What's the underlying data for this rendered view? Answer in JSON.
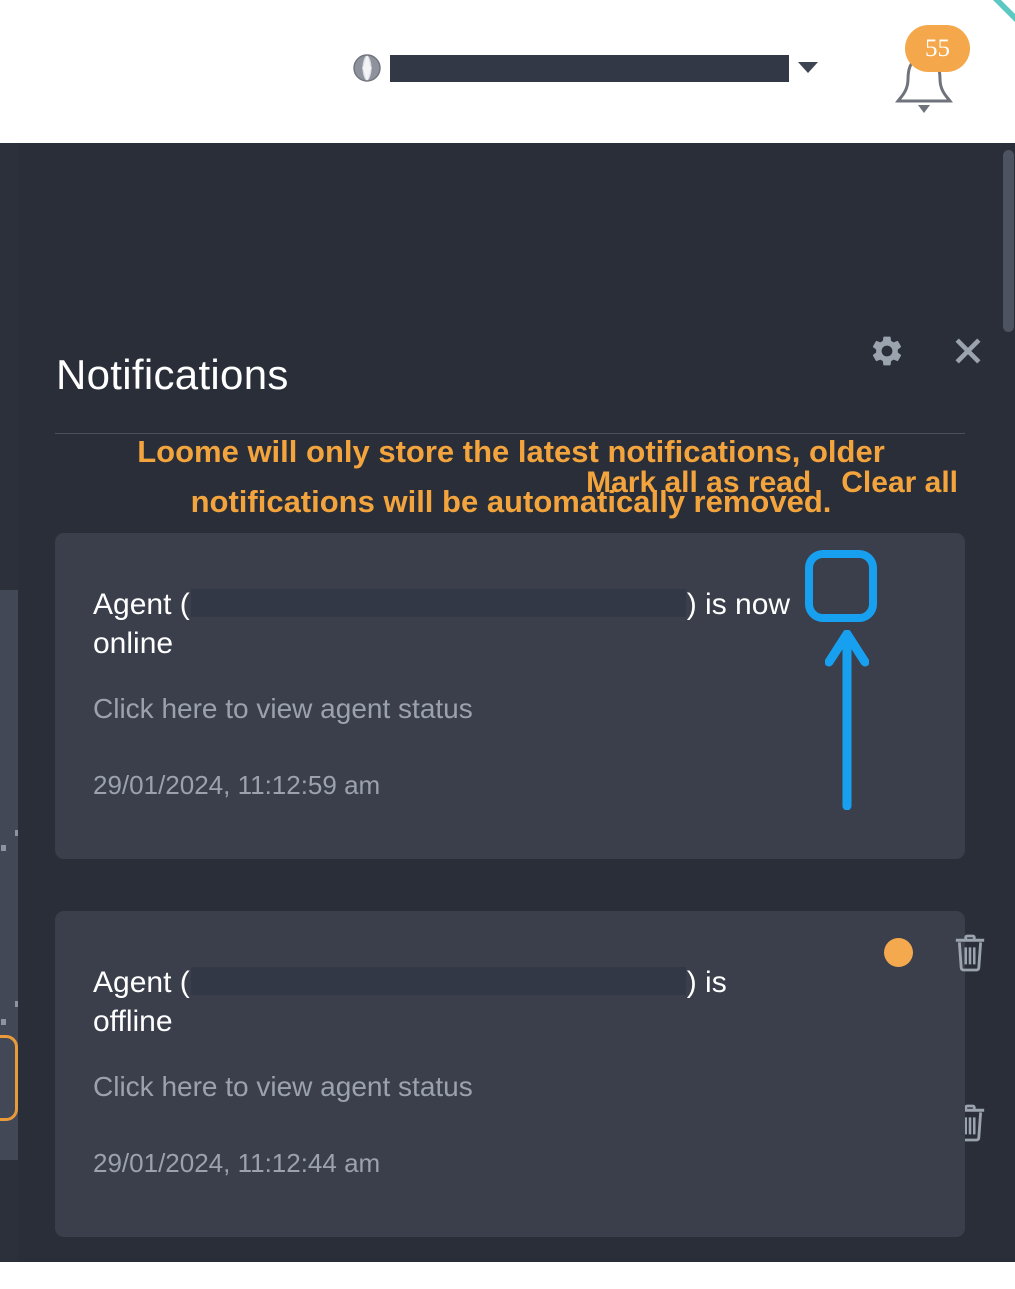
{
  "topbar": {
    "globe_icon": "globe-icon",
    "tenant_select": {
      "value": "",
      "redacted": true,
      "caret_icon": "chevron-down-icon"
    },
    "bell_icon": "bell-icon",
    "notification_count": "55",
    "corner_accent_color": "#5BC8C4"
  },
  "panel": {
    "title": "Notifications",
    "settings_icon": "gear-icon",
    "close_icon": "close-icon",
    "warning_text": "Loome will only store the latest notifications, older notifications will be automatically removed.",
    "mark_all_label": "Mark all as read",
    "clear_all_label": "Clear all"
  },
  "notifications": [
    {
      "title_prefix": "Agent (",
      "title_redacted": true,
      "title_suffix": ") is now online",
      "subtitle": "Click here to view agent status",
      "timestamp": "29/01/2024, 11:12:59 am",
      "unread": true,
      "unread_dot_title": "Unread indicator",
      "delete_icon": "trash-icon",
      "highlighted": true
    },
    {
      "title_prefix": "Agent (",
      "title_redacted": true,
      "title_suffix": ") is offline",
      "subtitle": "Click here to view agent status",
      "timestamp": "29/01/2024, 11:12:44 am",
      "unread": true,
      "unread_dot_title": "Unread indicator",
      "delete_icon": "trash-icon",
      "highlighted": false
    }
  ],
  "annotation": {
    "type": "arrow-highlight",
    "color": "#18A0F0",
    "points_at": "unread-indicator-dot-notification-1"
  },
  "colors": {
    "accent_orange": "#F3A43D",
    "unread_dot": "#F5A94E",
    "panel_bg": "#2A2E38",
    "card_bg": "#3A3F4B",
    "muted_text": "#9BA1AD",
    "annotation_blue": "#18A0F0"
  },
  "scrollbar": {
    "present": true
  }
}
